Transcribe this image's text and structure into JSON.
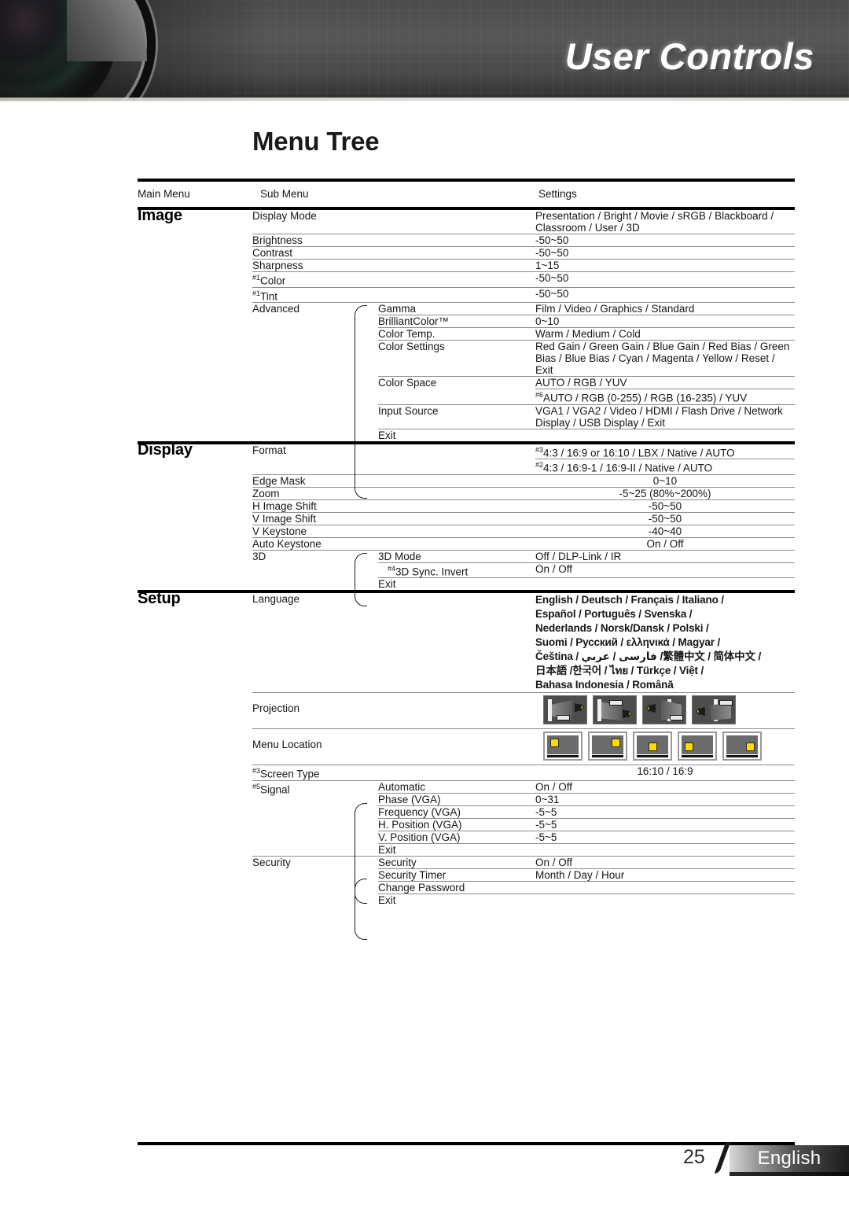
{
  "header": {
    "banner_title": "User Controls",
    "lens_icon": "camera-lens-image"
  },
  "page_title": "Menu Tree",
  "table": {
    "columns": [
      "Main Menu",
      "Sub Menu",
      "Settings"
    ],
    "sections": [
      {
        "name": "Image",
        "rows": [
          {
            "sub": "Display Mode",
            "setting": "Presentation / Bright / Movie / sRGB / Blackboard / Classroom / User / 3D"
          },
          {
            "sub": "Brightness",
            "setting": "-50~50"
          },
          {
            "sub": "Contrast",
            "setting": "-50~50"
          },
          {
            "sub": "Sharpness",
            "setting": "1~15"
          },
          {
            "sup": "#1",
            "sub": "Color",
            "setting": "-50~50"
          },
          {
            "sup": "#1",
            "sub": "Tint",
            "setting": "-50~50"
          },
          {
            "sub": "Advanced",
            "sub2": "Gamma",
            "setting": "Film / Video / Graphics / Standard"
          },
          {
            "sub2": "BrilliantColor™",
            "setting": "0~10"
          },
          {
            "sub2": "Color Temp.",
            "setting": "Warm / Medium / Cold"
          },
          {
            "sub2": "Color Settings",
            "setting": "Red Gain / Green Gain / Blue Gain / Red Bias / Green Bias / Blue Bias / Cyan / Magenta / Yellow / Reset / Exit"
          },
          {
            "sub2": "Color Space",
            "setting": "AUTO / RGB / YUV"
          },
          {
            "sub2": "",
            "sup_set": "#6",
            "setting": "AUTO / RGB (0-255) / RGB (16-235) / YUV"
          },
          {
            "sub2": "Input Source",
            "setting": "VGA1 / VGA2 / Video / HDMI / Flash Drive / Network Display / USB Display / Exit"
          },
          {
            "sub2": "Exit",
            "setting": ""
          }
        ]
      },
      {
        "name": "Display",
        "rows": [
          {
            "sub": "Format",
            "sup_set": "#3",
            "setting": "4:3 / 16:9 or 16:10 / LBX / Native / AUTO"
          },
          {
            "sub": "",
            "sup_set": "#2",
            "setting": "4:3 / 16:9-1 / 16:9-II / Native / AUTO"
          },
          {
            "sub": "Edge Mask",
            "setting": "0~10"
          },
          {
            "sub": "Zoom",
            "setting": "-5~25 (80%~200%)"
          },
          {
            "sub": "H Image Shift",
            "setting": "-50~50"
          },
          {
            "sub": "V Image Shift",
            "setting": "-50~50"
          },
          {
            "sub": "V Keystone",
            "setting": "-40~40"
          },
          {
            "sub": "Auto Keystone",
            "setting": "On / Off"
          },
          {
            "sub": "3D",
            "sub2": "3D Mode",
            "setting": "Off / DLP-Link / IR"
          },
          {
            "sup2": "#4",
            "sub2": "3D Sync. Invert",
            "setting": "On / Off"
          },
          {
            "sub2": "Exit",
            "setting": ""
          }
        ]
      },
      {
        "name": "Setup",
        "rows": [
          {
            "sub": "Language",
            "setting_lines": [
              "English / Deutsch / Français / Italiano /",
              "Español / Português / Svenska /",
              "Nederlands / Norsk/Dansk / Polski /",
              "Suomi / Русский / ελληνικά / Magyar /",
              "Čeština / فارسی / عربي /繁體中文 / 简体中文 /",
              "日本語 /한국어 / ไทย / Türkçe / Việt /",
              "Bahasa Indonesia / Română"
            ]
          },
          {
            "sub": "Projection",
            "setting_icons": "projection-icons"
          },
          {
            "sub": "Menu Location",
            "setting_icons": "menu-location-icons"
          },
          {
            "sup": "#3",
            "sub": "Screen Type",
            "setting": "16:10 / 16:9"
          },
          {
            "sup": "#5",
            "sub": "Signal",
            "sub2": "Automatic",
            "setting": "On / Off"
          },
          {
            "sub2": "Phase (VGA)",
            "setting": "0~31"
          },
          {
            "sub2": "Frequency (VGA)",
            "setting": "-5~5"
          },
          {
            "sub2": "H. Position (VGA)",
            "setting": "-5~5"
          },
          {
            "sub2": "V. Position (VGA)",
            "setting": "-5~5"
          },
          {
            "sub2": "Exit",
            "setting": ""
          },
          {
            "sub": "Security",
            "sub2": "Security",
            "setting": "On / Off"
          },
          {
            "sub2": "Security Timer",
            "setting": "Month / Day / Hour"
          },
          {
            "sub2": "Change Password",
            "setting": ""
          },
          {
            "sub2": "Exit",
            "setting": ""
          }
        ]
      }
    ]
  },
  "footer": {
    "page_number": "25",
    "language": "English"
  },
  "colors": {
    "rule": "#000000",
    "thin_rule": "#8c8c8c",
    "banner_bg": "#4f4f4f",
    "highlight_yellow": "#fcdc04"
  }
}
